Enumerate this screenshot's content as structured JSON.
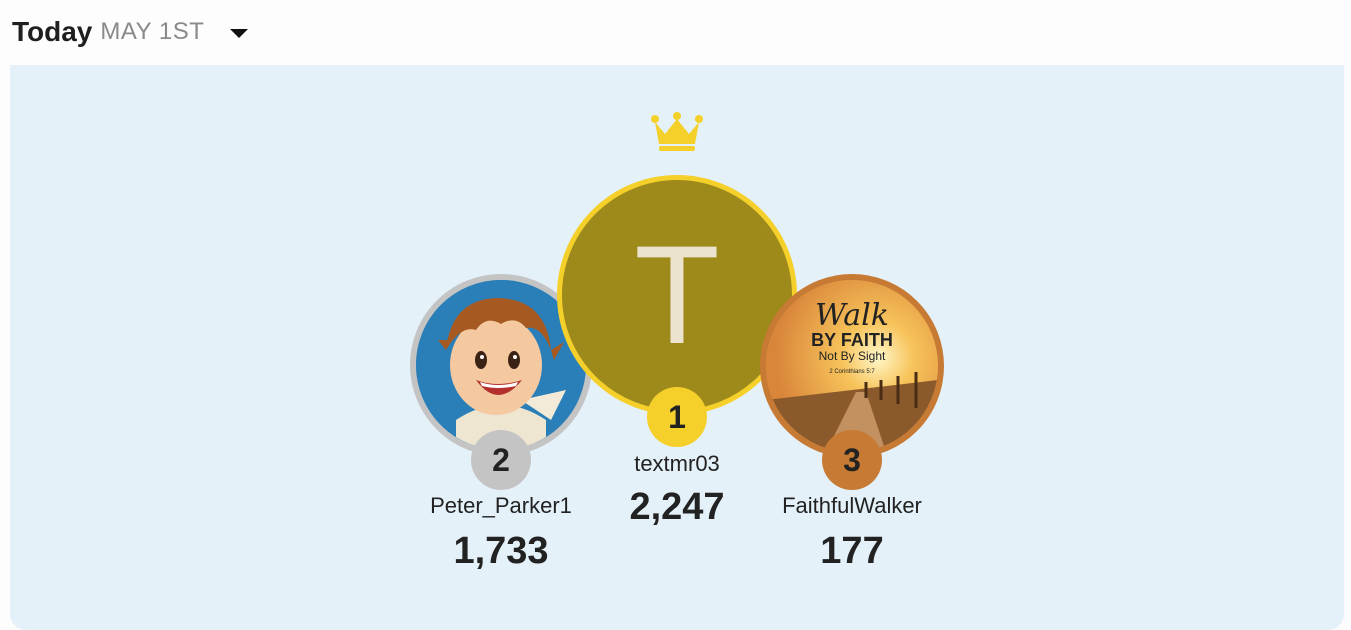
{
  "header": {
    "title": "Today",
    "date": "MAY 1ST"
  },
  "podium": [
    {
      "rank": "1",
      "username": "textmr03",
      "score": "2,247",
      "avatar_letter": "T",
      "ring_color": "#f5d02b"
    },
    {
      "rank": "2",
      "username": "Peter_Parker1",
      "score": "1,733",
      "ring_color": "#c4c4c4"
    },
    {
      "rank": "3",
      "username": "FaithfulWalker",
      "score": "177",
      "ring_color": "#c77a33"
    }
  ],
  "avatar3_text": {
    "line1": "Walk",
    "line2": "BY FAITH",
    "line3": "Not By Sight",
    "line4": "2 Corinthians 5:7"
  },
  "icons": {
    "crown": "crown-icon",
    "dropdown": "caret-down-icon"
  }
}
